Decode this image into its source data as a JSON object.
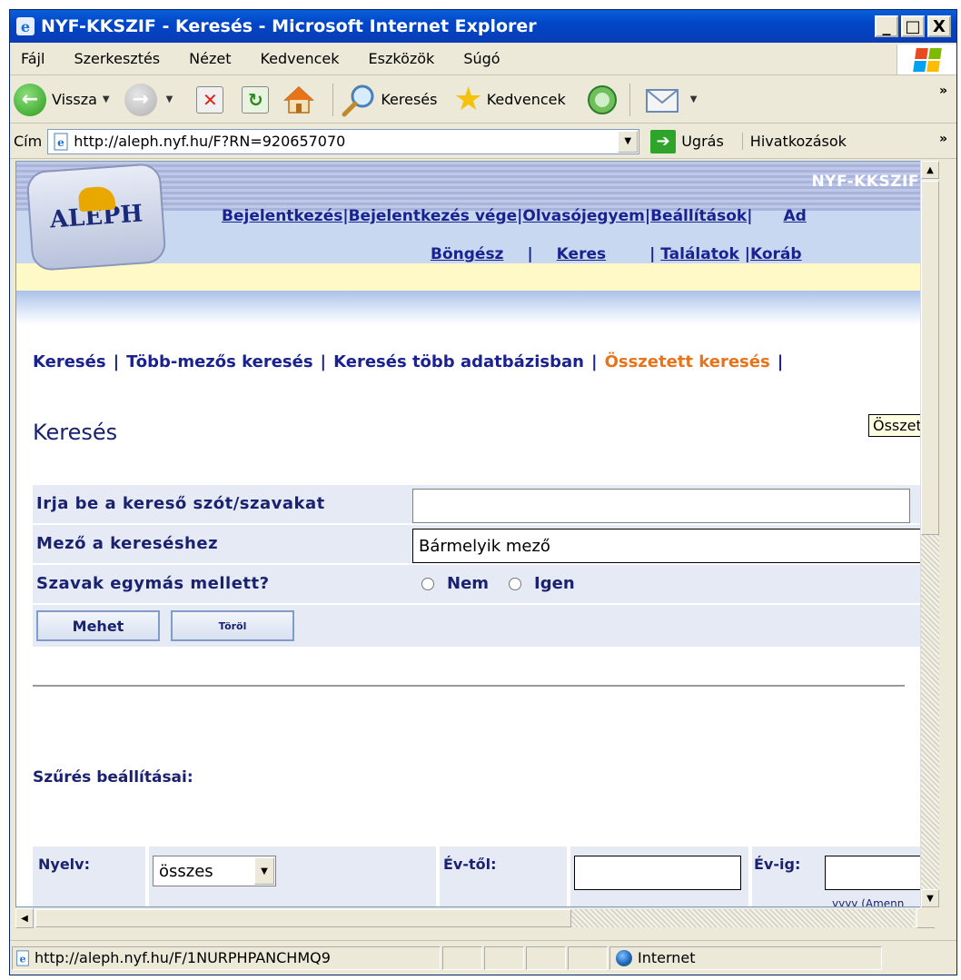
{
  "window": {
    "title": "NYF-KKSZIF - Keresés - Microsoft Internet Explorer",
    "buttons": [
      "_",
      "□",
      "X"
    ]
  },
  "menu": [
    "Fájl",
    "Szerkesztés",
    "Nézet",
    "Kedvencek",
    "Eszközök",
    "Súgó"
  ],
  "toolbar": {
    "back_label": "Vissza",
    "search_label": "Keresés",
    "favorites_label": "Kedvencek"
  },
  "address": {
    "label": "Cím",
    "url": "http://aleph.nyf.hu/F?RN=920657070",
    "go_label": "Ugrás",
    "links_label": "Hivatkozások"
  },
  "page": {
    "brand": "NYF-KKSZIF",
    "logo_text": "ALEPH",
    "top_links": [
      "Bejelentkezés",
      "Bejelentkezés vége",
      "Olvasójegyem",
      "Beállítások",
      "Ad"
    ],
    "sub_links": [
      "Böngész",
      "Keres",
      "Találatok",
      "Koráb"
    ],
    "nav_tabs": [
      "Keresés",
      "Több-mezős keresés",
      "Keresés több adatbázisban",
      "Összetett keresés"
    ],
    "active_tab_index": 3,
    "tooltip": "Összetett",
    "heading": "Keresés",
    "form": {
      "query_label": "Irja be a kereső szót/szavakat",
      "query_value": "",
      "field_label": "Mező a kereséshez",
      "field_value": "Bármelyik mező",
      "adjacent_label": "Szavak egymás mellett?",
      "option_no": "Nem",
      "option_yes": "Igen",
      "submit_label": "Mehet",
      "clear_label": "Töröl"
    },
    "filter": {
      "title": "Szűrés beállításai:",
      "language_label": "Nyelv:",
      "language_value": "összes",
      "year_from_label": "Év-től:",
      "year_to_label": "Év-ig:",
      "year_hint": "yyyy (Amenn"
    }
  },
  "status": {
    "url": "http://aleph.nyf.hu/F/1NURPHPANCHMQ9",
    "zone": "Internet"
  },
  "colors": {
    "title_blue": "#0046c8",
    "link_navy": "#1a2290",
    "active_orange": "#e8731a",
    "form_bg": "#e6eaf4"
  }
}
